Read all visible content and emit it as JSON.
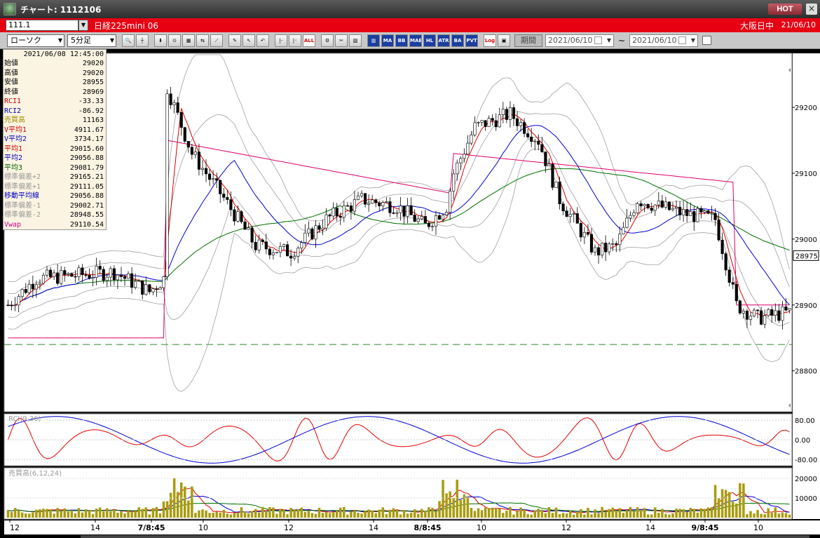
{
  "window": {
    "title": "チャート: 1112106",
    "hot_label": "HOT",
    "close_label": "×"
  },
  "symbol": {
    "code": "111.1",
    "name": "日経225mini 06",
    "session": "大阪日中",
    "date": "21/06/10"
  },
  "toolbar": {
    "chart_type": "ローソク",
    "interval": "5分足",
    "period_label": "期間",
    "date_from": "2021/06/10",
    "date_to": "2021/06/10",
    "range_sep": "~",
    "buttons": [
      {
        "icon": "zoom-icon",
        "label": "🔍"
      },
      {
        "icon": "crosshair-icon",
        "label": "┼"
      },
      {
        "sep": true
      },
      {
        "icon": "draw-icon",
        "label": "⬇"
      },
      {
        "icon": "magnet-icon",
        "label": "⊙"
      },
      {
        "icon": "bar-icon",
        "label": "▦"
      },
      {
        "icon": "compare-icon",
        "label": "⇆"
      },
      {
        "icon": "line-icon",
        "label": "⟋"
      },
      {
        "sep": true
      },
      {
        "icon": "pen-icon",
        "label": "✎"
      },
      {
        "icon": "cursor-icon",
        "label": "↖"
      },
      {
        "icon": "undo-icon",
        "label": "↶"
      },
      {
        "sep": true
      },
      {
        "icon": "candle-icon",
        "label": "|‑"
      },
      {
        "icon": "bar-chart-icon",
        "label": "|◦"
      },
      {
        "icon": "all-icon",
        "label": "ALL",
        "style": "red"
      },
      {
        "sep": true
      },
      {
        "icon": "settings-icon",
        "label": "⚙"
      },
      {
        "icon": "tool-icon",
        "label": "✂"
      },
      {
        "icon": "color-icon",
        "label": "▨"
      },
      {
        "sep": true
      },
      {
        "icon": "volume-icon",
        "label": "▥",
        "style": "blue"
      },
      {
        "icon": "ma-icon",
        "label": "MA",
        "style": "blue"
      },
      {
        "icon": "bb-icon",
        "label": "BB",
        "style": "blue"
      },
      {
        "icon": "mae-icon",
        "label": "MAE",
        "style": "blue"
      },
      {
        "icon": "hl-icon",
        "label": "HL",
        "style": "blue"
      },
      {
        "icon": "atr-icon",
        "label": "ATR",
        "style": "blue"
      },
      {
        "icon": "ba-icon",
        "label": "BA",
        "style": "blue"
      },
      {
        "icon": "pvt-icon",
        "label": "PVT",
        "style": "blue"
      },
      {
        "sep": true
      },
      {
        "icon": "log-icon",
        "label": "Log",
        "style": "red"
      },
      {
        "icon": "export-icon",
        "label": "▣"
      }
    ]
  },
  "info": {
    "datetime": "2021/06/08  12:45:00",
    "rows": [
      {
        "label": "始値",
        "value": "29020",
        "color": "#000000"
      },
      {
        "label": "高値",
        "value": "29020",
        "color": "#000000"
      },
      {
        "label": "安値",
        "value": "28955",
        "color": "#000000"
      },
      {
        "label": "終値",
        "value": "28969",
        "color": "#000000"
      },
      {
        "label": "RCI1",
        "value": "-33.33",
        "color": "#d00000"
      },
      {
        "label": "RCI2",
        "value": "-86.92",
        "color": "#0000c0"
      },
      {
        "label": "売買高",
        "value": "11163",
        "color": "#a08c00"
      },
      {
        "label": "V平均1",
        "value": "4911.67",
        "color": "#d00000"
      },
      {
        "label": "V平均2",
        "value": "3734.17",
        "color": "#0000c0"
      },
      {
        "label": "平均1",
        "value": "29015.60",
        "color": "#d00000"
      },
      {
        "label": "平均2",
        "value": "29056.88",
        "color": "#0000c0"
      },
      {
        "label": "平均3",
        "value": "29081.79",
        "color": "#006000"
      },
      {
        "label": "標準偏差+2",
        "value": "29165.21",
        "color": "#9a9a9a"
      },
      {
        "label": "標準偏差+1",
        "value": "29111.05",
        "color": "#9a9a9a"
      },
      {
        "label": "移動平均線",
        "value": "29056.88",
        "color": "#0000c0"
      },
      {
        "label": "標準偏差-1",
        "value": "29002.71",
        "color": "#9a9a9a"
      },
      {
        "label": "標準偏差-2",
        "value": "28948.55",
        "color": "#9a9a9a"
      },
      {
        "label": "Vwap",
        "value": "29110.54",
        "color": "#d00090"
      }
    ]
  },
  "chart_data": {
    "type": "candlestick",
    "price_axis": {
      "min": 28740,
      "max": 29280,
      "ticks": [
        "29200",
        "29100",
        "29000",
        "28900",
        "28800"
      ]
    },
    "current_price": "28975",
    "dashed_level": 28840,
    "rci": {
      "label": "RCI(9,36)",
      "ticks": [
        "80.00",
        "0.00",
        "-80.00"
      ]
    },
    "volume": {
      "label": "売買高(6,12,24)",
      "ticks": [
        "20000",
        "10000"
      ]
    },
    "x_labels": [
      "12",
      "14",
      "7/8:45",
      "10",
      "12",
      "14",
      "8/8:45",
      "10",
      "12",
      "14",
      "9/8:45",
      "10"
    ],
    "colors": {
      "red": "#e00000",
      "blue": "#0000d0",
      "green": "#007000",
      "pink": "#e0006a",
      "band": "#a0a0a0",
      "vol": "#a89c10"
    }
  }
}
